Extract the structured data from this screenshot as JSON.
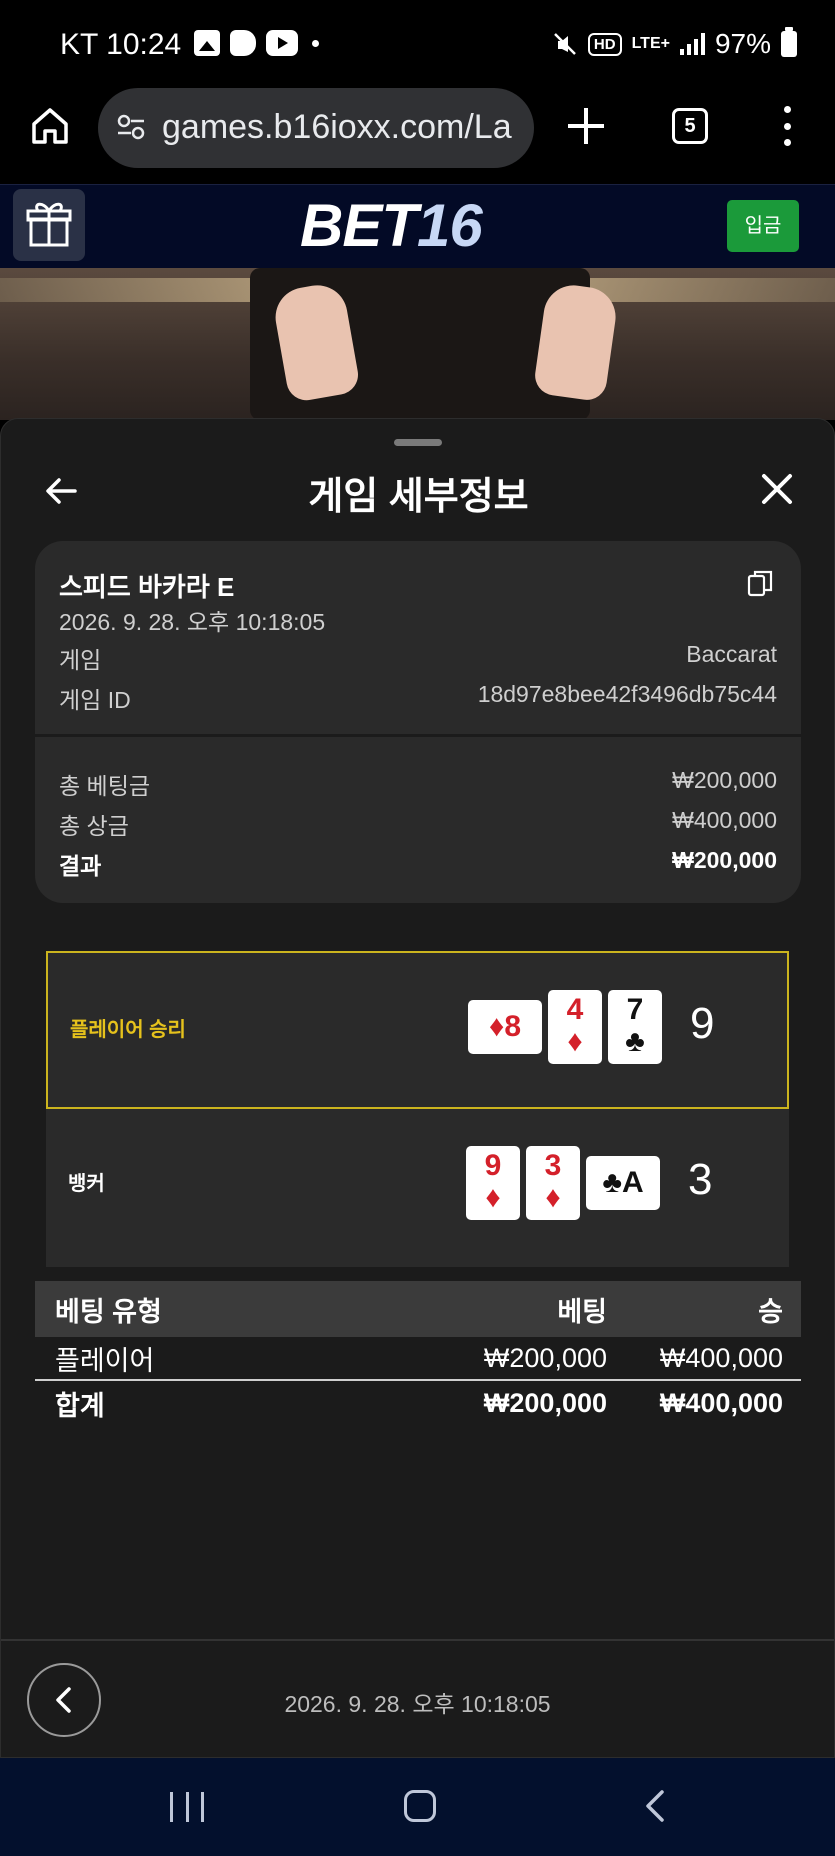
{
  "status_bar": {
    "carrier_time": "KT 10:24",
    "hd": "HD",
    "lte": "LTE+",
    "battery": "97%"
  },
  "browser": {
    "url": "games.b16ioxx.com/La",
    "tab_count": "5"
  },
  "site": {
    "brand_main": "BET",
    "brand_num": "16",
    "deposit_label": "입금"
  },
  "sheet": {
    "title": "게임 세부정보",
    "game_name": "스피드 바카라 E",
    "date": "2026. 9. 28. 오후 10:18:05",
    "rows": [
      {
        "label": "게임",
        "value": "Baccarat"
      },
      {
        "label": "게임 ID",
        "value": "18d97e8bee42f3496db75c44"
      }
    ],
    "totals": [
      {
        "label": "총 베팅금",
        "value": "₩200,000"
      },
      {
        "label": "총 상금",
        "value": "₩400,000"
      },
      {
        "label": "결과",
        "value": "₩200,000"
      }
    ]
  },
  "results": {
    "player": {
      "label": "플레이어 승리",
      "score": "9",
      "cards": [
        {
          "rank": "8",
          "suit": "♦",
          "color": "#d4202a",
          "sideways": true
        },
        {
          "rank": "4",
          "suit": "♦",
          "color": "#d4202a",
          "sideways": false
        },
        {
          "rank": "7",
          "suit": "♣",
          "color": "#111111",
          "sideways": false
        }
      ]
    },
    "banker": {
      "label": "뱅커",
      "score": "3",
      "cards": [
        {
          "rank": "9",
          "suit": "♦",
          "color": "#d4202a",
          "sideways": false
        },
        {
          "rank": "3",
          "suit": "♦",
          "color": "#d4202a",
          "sideways": false
        },
        {
          "rank": "A",
          "suit": "♣",
          "color": "#111111",
          "sideways": true
        }
      ]
    }
  },
  "bet_table": {
    "headers": [
      "베팅 유형",
      "베팅",
      "승"
    ],
    "rows": [
      [
        "플레이어",
        "₩200,000",
        "₩400,000"
      ],
      [
        "합계",
        "₩200,000",
        "₩400,000"
      ]
    ]
  },
  "footer": {
    "date": "2026. 9. 28. 오후 10:18:05"
  },
  "colors": {
    "player_highlight": "#cbb41e",
    "deposit_green": "#1b9a3a",
    "header_navy": "#030a26"
  }
}
